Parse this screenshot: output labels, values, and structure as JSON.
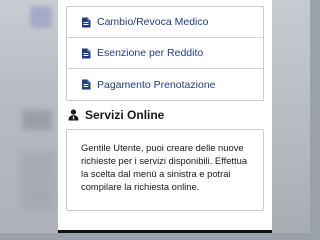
{
  "links": [
    {
      "label": "Cambio/Revoca Medico",
      "icon": "file-icon"
    },
    {
      "label": "Esenzione per Reddito",
      "icon": "file-icon"
    },
    {
      "label": "Pagamento Prenotazione",
      "icon": "file-icon"
    }
  ],
  "services": {
    "title": "Servizi Online",
    "icon": "user-icon",
    "message": "Gentile Utente, puoi creare delle nuove richieste per i servizi disponibili. Effettua la scelta dal menù a sinistra e potrai compilare la richiesta online."
  },
  "colors": {
    "link": "#1f3b8c",
    "border": "#c9cdd2",
    "text": "#1a1a1a"
  }
}
